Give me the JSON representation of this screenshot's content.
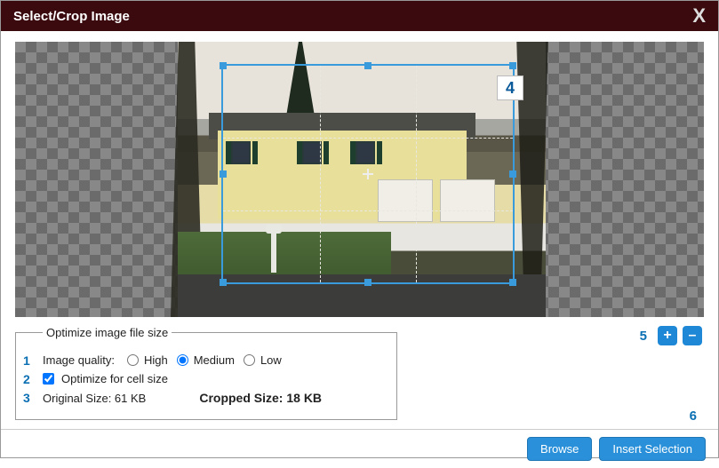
{
  "dialog": {
    "title": "Select/Crop Image",
    "close_label": "X"
  },
  "callouts": {
    "c1": "1",
    "c2": "2",
    "c3": "3",
    "c4": "4",
    "c5": "5",
    "c6": "6"
  },
  "optimize": {
    "legend": "Optimize image file size",
    "quality_label": "Image quality:",
    "quality_options": {
      "high": "High",
      "medium": "Medium",
      "low": "Low"
    },
    "quality_selected": "medium",
    "cell_checkbox_label": "Optimize for cell size",
    "cell_checked": true,
    "original_label": "Original Size: 61 KB",
    "cropped_label": "Cropped Size: 18 KB"
  },
  "zoom": {
    "plus": "+",
    "minus": "–"
  },
  "footer": {
    "browse": "Browse",
    "insert": "Insert Selection"
  }
}
